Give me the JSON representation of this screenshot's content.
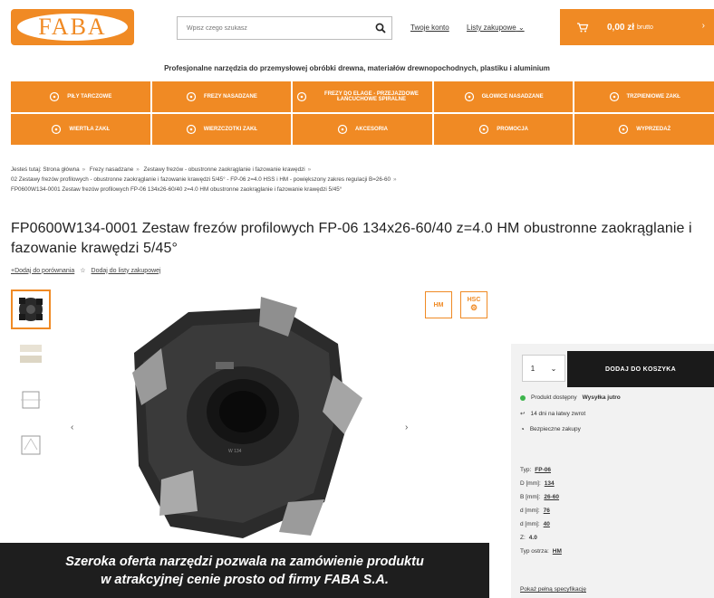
{
  "header": {
    "logo_text": "FABA",
    "search_placeholder": "Wpisz czego szukasz",
    "links": [
      "Twoje konto",
      "Listy zakupowe"
    ],
    "cart_value": "0,00 zł",
    "cart_sub": "brutto"
  },
  "tagline": "Profesjonalne narzędzia do przemysłowej obróbki drewna, materiałów drewnopochodnych, plastiku i aluminium",
  "categories": [
    {
      "label": "PIŁY TARCZOWE",
      "icon": "saw-blade-icon"
    },
    {
      "label": "FREZY NASADZANE",
      "icon": "cutter-icon"
    },
    {
      "label": "FREZY DO ELAGE - PRZEJAZDOWE ŁAŃCUCHOWE SPIRALNE",
      "icon": "router-bit-icon"
    },
    {
      "label": "GŁOWICE NASADZANE",
      "icon": "head-icon"
    },
    {
      "label": "TRZPIENIOWE ZAKŁ",
      "icon": "shank-icon"
    },
    {
      "label": "WIERTŁA ZAKŁ",
      "icon": "drill-icon"
    },
    {
      "label": "WIERZCZOTKI ZAKŁ",
      "icon": "brush-icon"
    },
    {
      "label": "AKCESORIA",
      "icon": "accessories-icon"
    },
    {
      "label": "PROMOCJA",
      "icon": "promo-icon"
    },
    {
      "label": "WYPRZEDAŻ",
      "icon": "sale-icon"
    }
  ],
  "breadcrumb": {
    "prefix": "Jesteś tutaj:",
    "items": [
      "Strona główna",
      "Frezy nasadzane",
      "Zestawy frezów - obustronne zaokrąglanie i fazowanie krawędzi",
      "02 Zestawy frezów profilowych - obustronne zaokrąglanie i fazowanie krawędzi 5/45° - FP-06 z=4.0 HSS i HM - powiększony zakres regulacji B=26-60",
      "FP0600W134-0001 Zestaw frezów profilowych FP-06 134x26-60/40 z=4.0 HM obustronne zaokrąglanie i fazowanie krawędzi 5/45°"
    ]
  },
  "product": {
    "title": "FP0600W134-0001 Zestaw frezów profilowych FP-06 134x26-60/40 z=4.0 HM obustronne zaokrąglanie i fazowanie krawędzi 5/45°",
    "compare_label": "Dodaj do porównania",
    "wishlist_label": "Dodaj do listy zakupowej",
    "badges": [
      "HM",
      "HSC"
    ]
  },
  "buybox": {
    "qty": "1",
    "add_label": "DODAJ DO KOSZYKA",
    "availability_label": "Produkt dostępny",
    "availability_value": "Wysyłka jutro",
    "returns": "14 dni na łatwy zwrot",
    "secure": "Bezpieczne zakupy",
    "specs": [
      {
        "label": "Typ:",
        "value": "FP-06",
        "link": true
      },
      {
        "label": "D [mm]:",
        "value": "134",
        "link": true
      },
      {
        "label": "B [mm]:",
        "value": "26-60",
        "link": true
      },
      {
        "label": "d [mm]:",
        "value": "76",
        "link": true
      },
      {
        "label": "d [mm]:",
        "value": "40",
        "link": true
      },
      {
        "label": "Z:",
        "value": "4.0",
        "link": false
      },
      {
        "label": "Typ ostrza:",
        "value": "HM",
        "link": true
      }
    ],
    "more_link": "Pokaż pełną specyfikację"
  },
  "banner": {
    "line1": "Szeroka oferta narzędzi pozwala na zamówienie produktu",
    "line2": "w atrakcyjnej cenie prosto od firmy FABA S.A."
  },
  "colors": {
    "accent": "#f08a24",
    "dark": "#1a1a1a",
    "available": "#3cb44b"
  }
}
